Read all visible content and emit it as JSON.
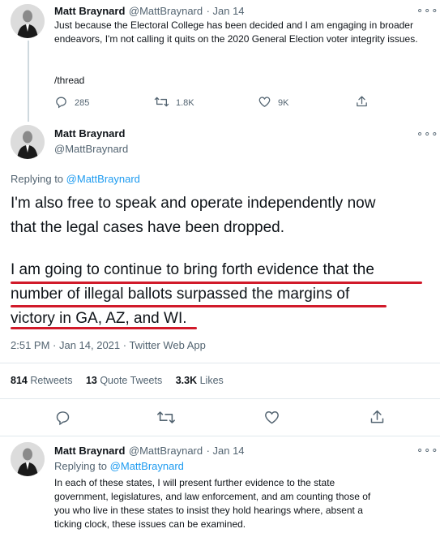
{
  "tweet1": {
    "name": "Matt Braynard",
    "handle": "@MattBraynard",
    "time": "· Jan 14",
    "more": "∘∘∘",
    "text": "Just because the Electoral College has been decided and I am engaging in broader endeavors, I'm not calling it quits on the 2020 General Election voter integrity issues.",
    "text2": "/thread",
    "actions": {
      "replies": "285",
      "retweets": "1.8K",
      "likes": "9K"
    }
  },
  "tweet2": {
    "name": "Matt Braynard",
    "handle": "@MattBraynard",
    "more": "∘∘∘",
    "replying_prefix": "Replying to",
    "replying_to": "@MattBraynard",
    "para1_line1": "I'm also free to speak and operate independently now",
    "para1_line2": "that the legal cases have been dropped.",
    "para2_line1": "I am going to continue to bring forth evidence that the",
    "para2_line2": "number of illegal ballots surpassed the margins of",
    "para2_line3": "victory in GA, AZ, and WI.",
    "timestamp": "2:51 PM · Jan 14, 2021 · Twitter Web App",
    "stats": {
      "retweets_count": "814",
      "retweets_label": "Retweets",
      "quotes_count": "13",
      "quotes_label": "Quote Tweets",
      "likes_count": "3.3K",
      "likes_label": "Likes"
    }
  },
  "tweet3": {
    "name": "Matt Braynard",
    "handle": "@MattBraynard",
    "time": "· Jan 14",
    "more": "∘∘∘",
    "replying_prefix": "Replying to",
    "replying_to": "@MattBraynard",
    "line1": "In each of these states, I will present further evidence to the state",
    "line2": "government, legislatures, and law enforcement, and am counting those of",
    "line3": "you who live in these states to insist they hold hearings where, absent a",
    "line4": "ticking clock, these issues can be examined."
  },
  "icons": [
    "reply-icon",
    "retweet-icon",
    "like-icon",
    "share-icon",
    "more-icon"
  ],
  "colors": {
    "accent": "#1d9bf0",
    "underline": "#d11a2a",
    "muted": "#536471"
  }
}
